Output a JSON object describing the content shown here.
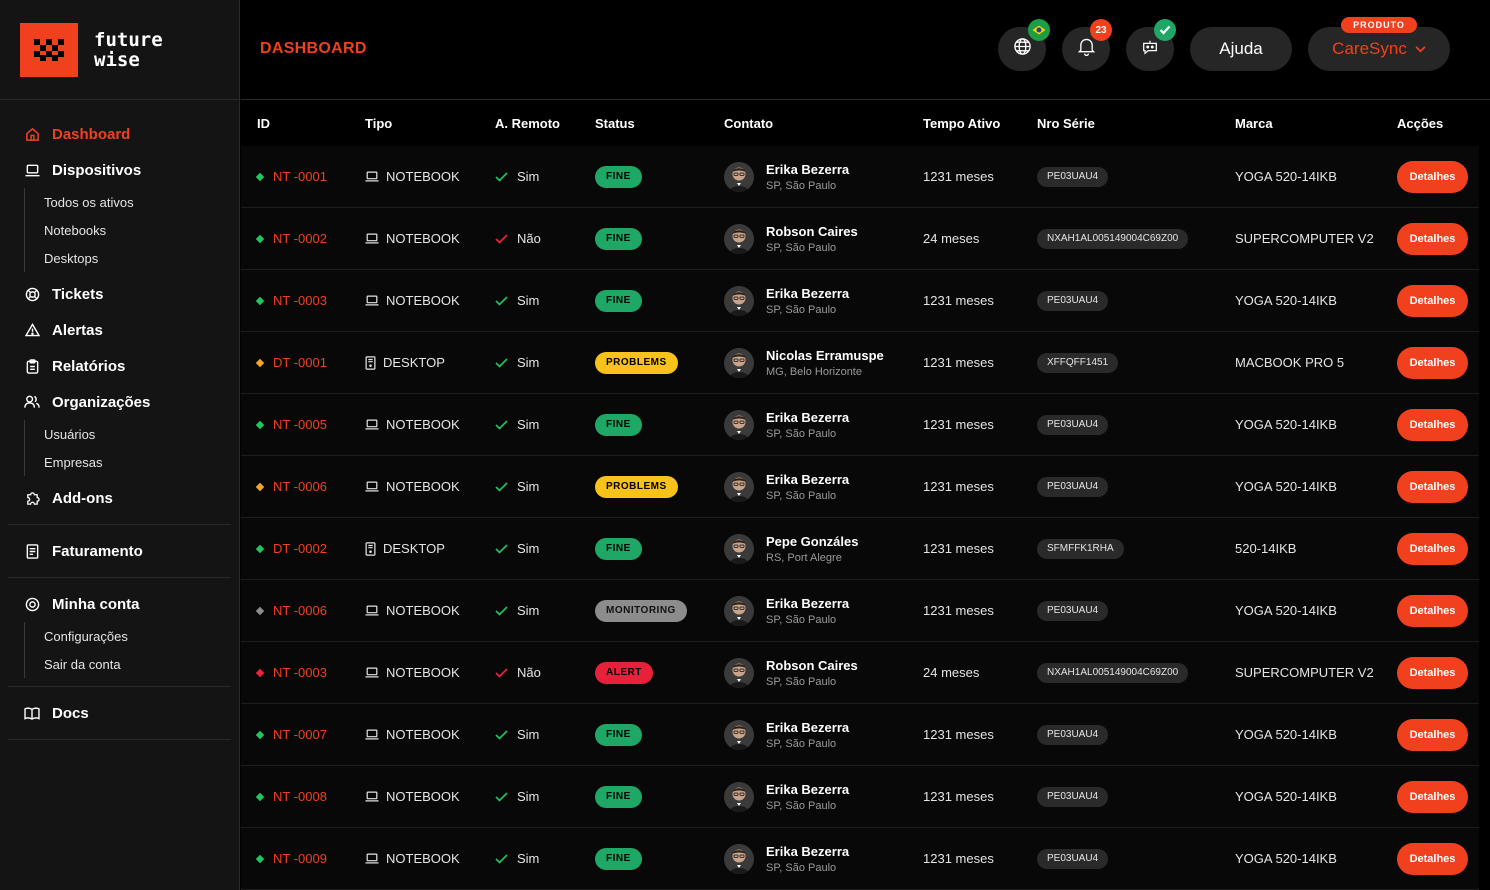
{
  "logo": {
    "line1": "future",
    "line2": "wise"
  },
  "header": {
    "title": "DASHBOARD",
    "notifications_count": "23",
    "help_label": "Ajuda",
    "product_tag": "PRODUTO",
    "product_label": "CareSync"
  },
  "sidebar": {
    "dashboard": "Dashboard",
    "dispositivos": "Dispositivos",
    "dispositivos_sub": [
      "Todos os ativos",
      "Notebooks",
      "Desktops"
    ],
    "tickets": "Tickets",
    "alertas": "Alertas",
    "relatorios": "Relatórios",
    "organizacoes": "Organizações",
    "organizacoes_sub": [
      "Usuários",
      "Empresas"
    ],
    "addons": "Add-ons",
    "faturamento": "Faturamento",
    "minha_conta": "Minha conta",
    "minha_conta_sub": [
      "Configurações",
      "Sair da conta"
    ],
    "docs": "Docs"
  },
  "table": {
    "columns": [
      "ID",
      "Tipo",
      "A. Remoto",
      "Status",
      "Contato",
      "Tempo Ativo",
      "Nro Série",
      "Marca",
      "Acções"
    ],
    "action_label": "Detalhes",
    "status_colors": {
      "FINE": "#1fa865",
      "PROBLEMS": "#f7c21a",
      "MONITORING": "#8c8c8c",
      "ALERT": "#e8213a"
    },
    "dot_colors": {
      "green": "#22c55e",
      "orange": "#f5a623",
      "gray": "#8c8c8c",
      "red": "#ef233c"
    },
    "rows": [
      {
        "dot": "green",
        "id": "NT -0001",
        "tipo": "NOTEBOOK",
        "tipo_icon": "laptop-icon",
        "remoto": "Sim",
        "remoto_ok": true,
        "status": "FINE",
        "name": "Erika Bezerra",
        "loc": "SP, São Paulo",
        "tempo": "1231 meses",
        "serie": "PE03UAU4",
        "marca": "YOGA 520-14IKB"
      },
      {
        "dot": "green",
        "id": "NT -0002",
        "tipo": "NOTEBOOK",
        "tipo_icon": "laptop-icon",
        "remoto": "Não",
        "remoto_ok": false,
        "status": "FINE",
        "name": "Robson Caires",
        "loc": "SP, São Paulo",
        "tempo": "24 meses",
        "serie": "NXAH1AL005149004C69Z00",
        "marca": "SUPERCOMPUTER V2"
      },
      {
        "dot": "green",
        "id": "NT -0003",
        "tipo": "NOTEBOOK",
        "tipo_icon": "laptop-icon",
        "remoto": "Sim",
        "remoto_ok": true,
        "status": "FINE",
        "name": "Erika Bezerra",
        "loc": "SP, São Paulo",
        "tempo": "1231 meses",
        "serie": "PE03UAU4",
        "marca": "YOGA 520-14IKB"
      },
      {
        "dot": "orange",
        "id": "DT -0001",
        "tipo": "DESKTOP",
        "tipo_icon": "desktop-icon",
        "remoto": "Sim",
        "remoto_ok": true,
        "status": "PROBLEMS",
        "name": "Nicolas Erramuspe",
        "loc": "MG, Belo Horizonte",
        "tempo": "1231 meses",
        "serie": "XFFQFF1451",
        "marca": "MACBOOK PRO 5"
      },
      {
        "dot": "green",
        "id": "NT -0005",
        "tipo": "NOTEBOOK",
        "tipo_icon": "laptop-icon",
        "remoto": "Sim",
        "remoto_ok": true,
        "status": "FINE",
        "name": "Erika Bezerra",
        "loc": "SP, São Paulo",
        "tempo": "1231 meses",
        "serie": "PE03UAU4",
        "marca": "YOGA 520-14IKB"
      },
      {
        "dot": "orange",
        "id": "NT -0006",
        "tipo": "NOTEBOOK",
        "tipo_icon": "laptop-icon",
        "remoto": "Sim",
        "remoto_ok": true,
        "status": "PROBLEMS",
        "name": "Erika Bezerra",
        "loc": "SP, São Paulo",
        "tempo": "1231 meses",
        "serie": "PE03UAU4",
        "marca": "YOGA 520-14IKB"
      },
      {
        "dot": "green",
        "id": "DT -0002",
        "tipo": "DESKTOP",
        "tipo_icon": "desktop-icon",
        "remoto": "Sim",
        "remoto_ok": true,
        "status": "FINE",
        "name": "Pepe Gonzáles",
        "loc": "RS, Port Alegre",
        "tempo": "1231 meses",
        "serie": "SFMFFK1RHA",
        "marca": "520-14IKB"
      },
      {
        "dot": "gray",
        "id": "NT -0006",
        "tipo": "NOTEBOOK",
        "tipo_icon": "laptop-icon",
        "remoto": "Sim",
        "remoto_ok": true,
        "status": "MONITORING",
        "name": "Erika Bezerra",
        "loc": "SP, São Paulo",
        "tempo": "1231 meses",
        "serie": "PE03UAU4",
        "marca": "YOGA 520-14IKB"
      },
      {
        "dot": "red",
        "id": "NT -0003",
        "tipo": "NOTEBOOK",
        "tipo_icon": "laptop-icon",
        "remoto": "Não",
        "remoto_ok": false,
        "status": "ALERT",
        "name": "Robson Caires",
        "loc": "SP, São Paulo",
        "tempo": "24 meses",
        "serie": "NXAH1AL005149004C69Z00",
        "marca": "SUPERCOMPUTER V2"
      },
      {
        "dot": "green",
        "id": "NT -0007",
        "tipo": "NOTEBOOK",
        "tipo_icon": "laptop-icon",
        "remoto": "Sim",
        "remoto_ok": true,
        "status": "FINE",
        "name": "Erika Bezerra",
        "loc": "SP, São Paulo",
        "tempo": "1231 meses",
        "serie": "PE03UAU4",
        "marca": "YOGA 520-14IKB"
      },
      {
        "dot": "green",
        "id": "NT -0008",
        "tipo": "NOTEBOOK",
        "tipo_icon": "laptop-icon",
        "remoto": "Sim",
        "remoto_ok": true,
        "status": "FINE",
        "name": "Erika Bezerra",
        "loc": "SP, São Paulo",
        "tempo": "1231 meses",
        "serie": "PE03UAU4",
        "marca": "YOGA 520-14IKB"
      },
      {
        "dot": "green",
        "id": "NT -0009",
        "tipo": "NOTEBOOK",
        "tipo_icon": "laptop-icon",
        "remoto": "Sim",
        "remoto_ok": true,
        "status": "FINE",
        "name": "Erika Bezerra",
        "loc": "SP, São Paulo",
        "tempo": "1231 meses",
        "serie": "PE03UAU4",
        "marca": "YOGA 520-14IKB"
      }
    ]
  }
}
